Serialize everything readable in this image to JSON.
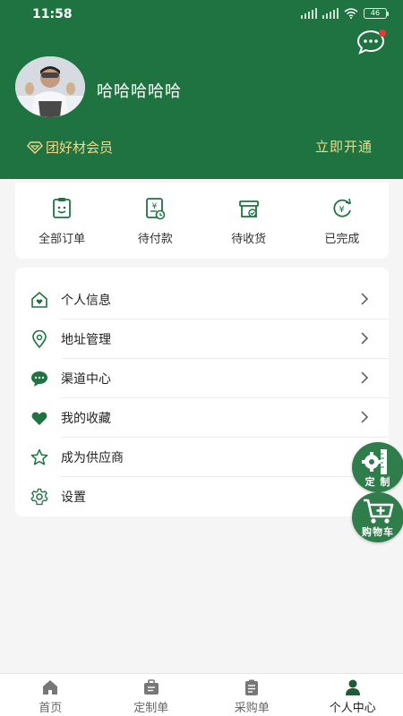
{
  "status_bar": {
    "time": "11:58",
    "battery": "46"
  },
  "profile": {
    "username": "哈哈哈哈哈"
  },
  "membership": {
    "label": "团好材会员",
    "action": "立即开通"
  },
  "orders": [
    {
      "label": "全部订单",
      "icon": "clipboard-face-icon"
    },
    {
      "label": "待付款",
      "icon": "bill-yen-icon"
    },
    {
      "label": "待收货",
      "icon": "box-check-icon"
    },
    {
      "label": "已完成",
      "icon": "yen-refresh-icon"
    }
  ],
  "menu": [
    {
      "label": "个人信息",
      "icon": "home-heart-icon"
    },
    {
      "label": "地址管理",
      "icon": "location-pin-icon"
    },
    {
      "label": "渠道中心",
      "icon": "chat-bubble-icon"
    },
    {
      "label": "我的收藏",
      "icon": "heart-icon"
    },
    {
      "label": "成为供应商",
      "icon": "star-icon"
    },
    {
      "label": "设置",
      "icon": "gear-icon"
    }
  ],
  "floating": {
    "customize": "定 制",
    "cart": "购物车"
  },
  "tabs": [
    {
      "label": "首页",
      "icon": "home-icon"
    },
    {
      "label": "定制单",
      "icon": "briefcase-icon"
    },
    {
      "label": "采购单",
      "icon": "clipboard-list-icon"
    },
    {
      "label": "个人中心",
      "icon": "person-icon",
      "active": true
    }
  ],
  "colors": {
    "brand_green": "#1e7341",
    "gold": "#f2d88a",
    "notification_red": "#e53935"
  }
}
